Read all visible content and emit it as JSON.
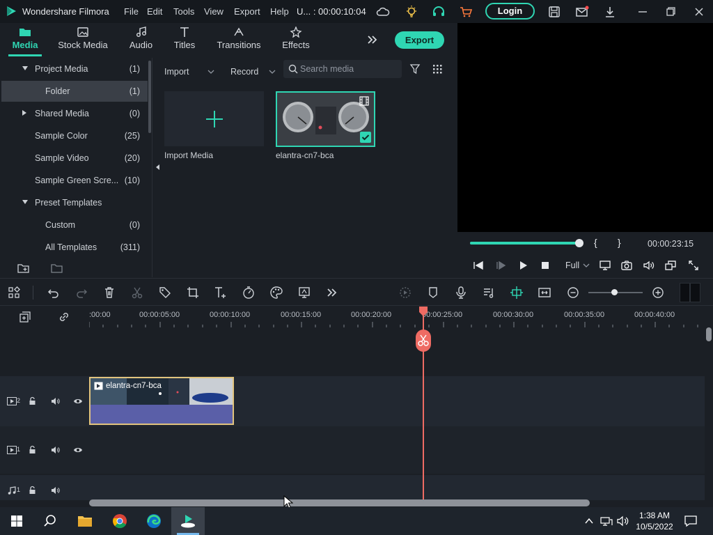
{
  "titlebar": {
    "app_name": "Wondershare Filmora",
    "menus": [
      "File",
      "Edit",
      "Tools",
      "View",
      "Export",
      "Help"
    ],
    "project_time": "U... : 00:00:10:04",
    "login_label": "Login"
  },
  "media_tabs": [
    {
      "label": "Media",
      "icon": "folder-icon",
      "active": true
    },
    {
      "label": "Stock Media",
      "icon": "image-icon"
    },
    {
      "label": "Audio",
      "icon": "music-note-icon"
    },
    {
      "label": "Titles",
      "icon": "text-t-icon"
    },
    {
      "label": "Transitions",
      "icon": "transition-icon"
    },
    {
      "label": "Effects",
      "icon": "effects-icon"
    }
  ],
  "export_label": "Export",
  "tree": [
    {
      "label": "Project Media",
      "count": "(1)",
      "caret": "down"
    },
    {
      "label": "Folder",
      "count": "(1)",
      "selected": true
    },
    {
      "label": "Shared Media",
      "count": "(0)",
      "caret": "right"
    },
    {
      "label": "Sample Color",
      "count": "(25)"
    },
    {
      "label": "Sample Video",
      "count": "(20)"
    },
    {
      "label": "Sample Green Scre...",
      "count": "(10)"
    },
    {
      "label": "Preset Templates",
      "count": "",
      "caret": "down"
    },
    {
      "label": "Custom",
      "count": "(0)"
    },
    {
      "label": "All Templates",
      "count": "(311)"
    }
  ],
  "media_bar": {
    "import_label": "Import",
    "record_label": "Record",
    "search_placeholder": "Search media"
  },
  "media_items": {
    "import_label": "Import Media",
    "clip_label": "elantra-cn7-bca"
  },
  "preview": {
    "time": "00:00:23:15",
    "bracket_open": "{",
    "bracket_close": "}",
    "quality": "Full",
    "progress": 1.0
  },
  "ruler": [
    "00:00",
    "00:00:05:00",
    "00:00:10:00",
    "00:00:15:00",
    "00:00:20:00",
    "00:00:25:00",
    "00:00:30:00",
    "00:00:35:00",
    "00:00:40:00"
  ],
  "ruler_first_label": ":00:00",
  "tracks": {
    "video2_num": "2",
    "video1_num": "1",
    "audio1_num": "1",
    "clip_name": "elantra-cn7-bca"
  },
  "taskbar": {
    "time": "1:38 AM",
    "date": "10/5/2022"
  },
  "colors": {
    "accent": "#2fd6b3",
    "playhead": "#ee6b63",
    "clip_border": "#e2c47e"
  }
}
